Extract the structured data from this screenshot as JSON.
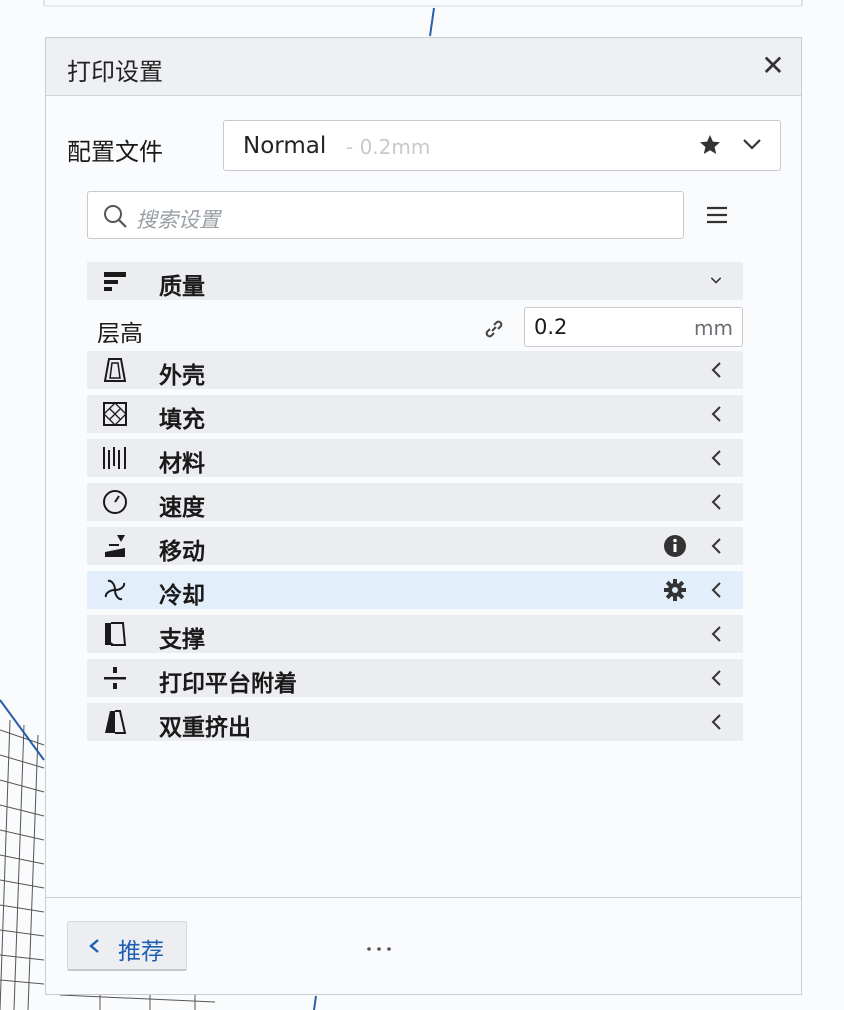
{
  "panel": {
    "title": "打印设置",
    "close_label": "✕"
  },
  "profile": {
    "label": "配置文件",
    "name": "Normal",
    "detail": "- 0.2mm"
  },
  "search": {
    "placeholder": "搜索设置"
  },
  "categories": [
    {
      "label": "质量",
      "icon": "quality-icon",
      "expanded": true
    },
    {
      "label": "外壳",
      "icon": "shell-icon"
    },
    {
      "label": "填充",
      "icon": "infill-icon"
    },
    {
      "label": "材料",
      "icon": "material-icon"
    },
    {
      "label": "速度",
      "icon": "speed-icon"
    },
    {
      "label": "移动",
      "icon": "travel-icon",
      "extra": "info-icon"
    },
    {
      "label": "冷却",
      "icon": "cooling-icon",
      "extra": "gear-icon",
      "active": true
    },
    {
      "label": "支撑",
      "icon": "support-icon"
    },
    {
      "label": "打印平台附着",
      "icon": "adhesion-icon"
    },
    {
      "label": "双重挤出",
      "icon": "dual-extrusion-icon"
    }
  ],
  "setting": {
    "label": "层高",
    "value": "0.2",
    "unit": "mm"
  },
  "footer": {
    "recommend_label": "推荐"
  },
  "colors": {
    "accent": "#1f5fb3",
    "active_row": "#e3eefb",
    "category_bg": "#ebedf0"
  }
}
